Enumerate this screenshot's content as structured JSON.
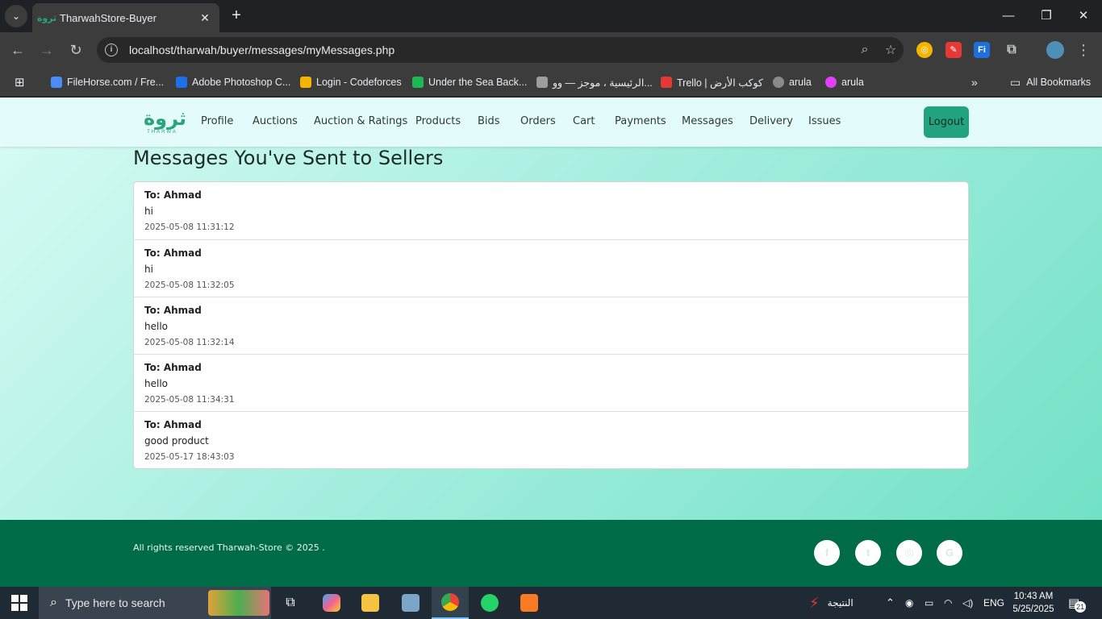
{
  "browser": {
    "tab_title": "TharwahStore-Buyer",
    "tab_favicon": "ثروة",
    "url": "localhost/tharwah/buyer/messages/myMessages.php",
    "bookmarks": [
      {
        "label": "FileHorse.com / Fre...",
        "color": "#4a8df6"
      },
      {
        "label": "Adobe Photoshop C...",
        "color": "#1f6feb"
      },
      {
        "label": "Login - Codeforces",
        "color": "#f4b400"
      },
      {
        "label": "Under the Sea Back...",
        "color": "#1db954"
      },
      {
        "label": "الرئيسية ، موجز — وو...",
        "color": "#9e9e9e"
      },
      {
        "label": "Trello | كوكب الأرض",
        "color": "#e53935"
      },
      {
        "label": "arula",
        "color": "#8a8a8a"
      },
      {
        "label": "arula",
        "color": "#e040fb"
      }
    ],
    "all_bookmarks": "All Bookmarks"
  },
  "nav": {
    "logo_ar": "ثروة",
    "logo_en": "THARWA",
    "links": [
      "Profile",
      "Auctions",
      "Auction & Ratings",
      "Products",
      "Bids",
      "Orders",
      "Cart",
      "Payments",
      "Messages",
      "Delivery",
      "Issues"
    ],
    "logout": "Logout"
  },
  "page": {
    "heading": "Messages You've Sent to Sellers",
    "messages": [
      {
        "to": "To: Ahmad",
        "body": "hi",
        "time": "2025-05-08 11:31:12"
      },
      {
        "to": "To: Ahmad",
        "body": "hi",
        "time": "2025-05-08 11:32:05"
      },
      {
        "to": "To: Ahmad",
        "body": "hello",
        "time": "2025-05-08 11:32:14"
      },
      {
        "to": "To: Ahmad",
        "body": "hello",
        "time": "2025-05-08 11:34:31"
      },
      {
        "to": "To: Ahmad",
        "body": "good product",
        "time": "2025-05-17 18:43:03"
      }
    ]
  },
  "footer": {
    "text": "All rights reserved Tharwah-Store © 2025 .",
    "social": [
      "facebook-icon",
      "twitter-icon",
      "instagram-icon",
      "google-icon"
    ]
  },
  "taskbar": {
    "search_placeholder": "Type here to search",
    "weather_label": "النتيجة",
    "language": "ENG",
    "time": "10:43 AM",
    "date": "5/25/2025",
    "notification_count": "21"
  },
  "colors": {
    "brand": "#2aa57a",
    "logout_bg": "#22a37f",
    "footer_bg": "#006b47"
  }
}
